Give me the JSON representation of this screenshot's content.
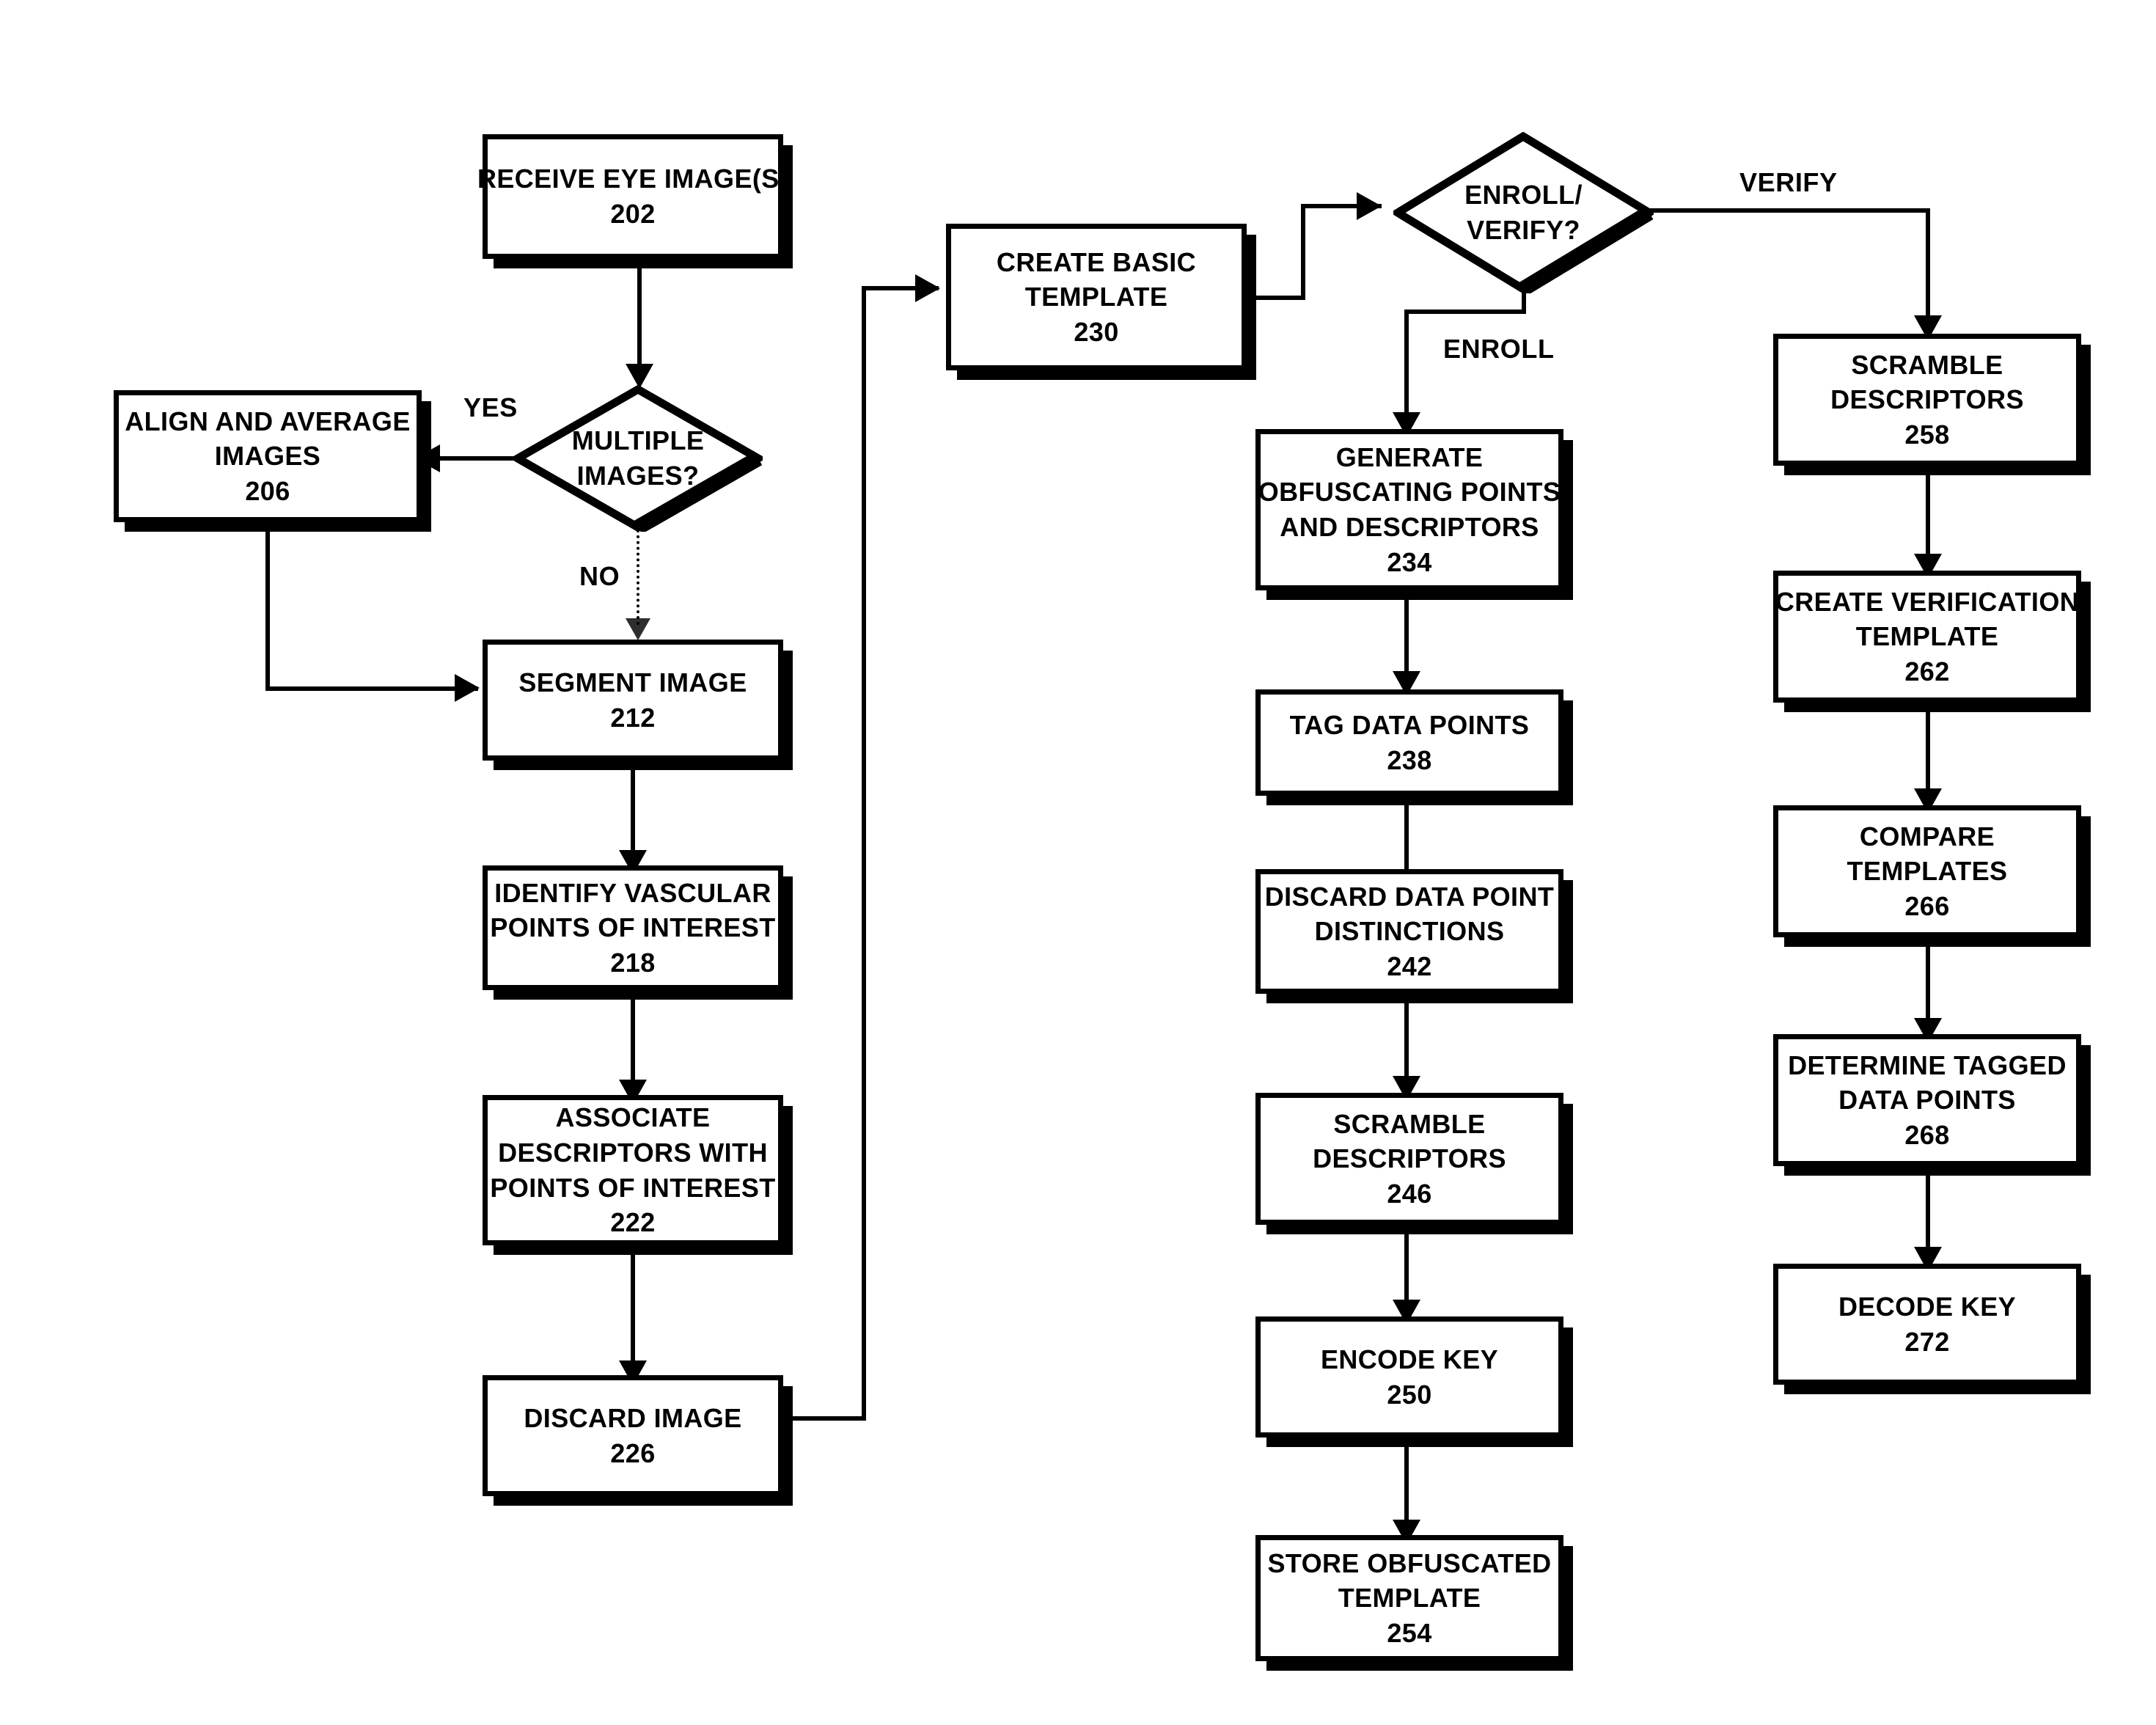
{
  "diagram": {
    "type": "flowchart",
    "title": "",
    "nodes": [
      {
        "id": "202",
        "shape": "process",
        "lines": [
          "RECEIVE EYE IMAGE(S)"
        ],
        "number": "202"
      },
      {
        "id": "204",
        "shape": "decision",
        "lines": [
          "MULTIPLE",
          "IMAGES?"
        ],
        "number": ""
      },
      {
        "id": "206",
        "shape": "process",
        "lines": [
          "ALIGN AND AVERAGE",
          "IMAGES"
        ],
        "number": "206"
      },
      {
        "id": "212",
        "shape": "process",
        "lines": [
          "SEGMENT IMAGE"
        ],
        "number": "212"
      },
      {
        "id": "218",
        "shape": "process",
        "lines": [
          "IDENTIFY VASCULAR",
          "POINTS OF INTEREST"
        ],
        "number": "218"
      },
      {
        "id": "222",
        "shape": "process",
        "lines": [
          "ASSOCIATE",
          "DESCRIPTORS WITH",
          "POINTS OF INTEREST"
        ],
        "number": "222"
      },
      {
        "id": "226",
        "shape": "process",
        "lines": [
          "DISCARD IMAGE"
        ],
        "number": "226"
      },
      {
        "id": "230",
        "shape": "process",
        "lines": [
          "CREATE BASIC",
          "TEMPLATE"
        ],
        "number": "230"
      },
      {
        "id": "232",
        "shape": "decision",
        "lines": [
          "ENROLL/",
          "VERIFY?"
        ],
        "number": ""
      },
      {
        "id": "234",
        "shape": "process",
        "lines": [
          "GENERATE",
          "OBFUSCATING POINTS",
          "AND DESCRIPTORS"
        ],
        "number": "234"
      },
      {
        "id": "238",
        "shape": "process",
        "lines": [
          "TAG DATA POINTS"
        ],
        "number": "238"
      },
      {
        "id": "242",
        "shape": "process",
        "lines": [
          "DISCARD DATA POINT",
          "DISTINCTIONS"
        ],
        "number": "242"
      },
      {
        "id": "246",
        "shape": "process",
        "lines": [
          "SCRAMBLE",
          "DESCRIPTORS"
        ],
        "number": "246"
      },
      {
        "id": "250",
        "shape": "process",
        "lines": [
          "ENCODE KEY"
        ],
        "number": "250"
      },
      {
        "id": "254",
        "shape": "process",
        "lines": [
          "STORE OBFUSCATED",
          "TEMPLATE"
        ],
        "number": "254"
      },
      {
        "id": "258",
        "shape": "process",
        "lines": [
          "SCRAMBLE",
          "DESCRIPTORS"
        ],
        "number": "258"
      },
      {
        "id": "262",
        "shape": "process",
        "lines": [
          "CREATE VERIFICATION",
          "TEMPLATE"
        ],
        "number": "262"
      },
      {
        "id": "266",
        "shape": "process",
        "lines": [
          "COMPARE",
          "TEMPLATES"
        ],
        "number": "266"
      },
      {
        "id": "268",
        "shape": "process",
        "lines": [
          "DETERMINE TAGGED",
          "DATA POINTS"
        ],
        "number": "268"
      },
      {
        "id": "272",
        "shape": "process",
        "lines": [
          "DECODE KEY"
        ],
        "number": "272"
      }
    ],
    "edge_labels": {
      "yes": "YES",
      "no": "NO",
      "enroll": "ENROLL",
      "verify": "VERIFY"
    },
    "colors": {
      "stroke": "#000000",
      "fill": "#ffffff",
      "text": "#000000"
    }
  },
  "n202": {
    "l0": "RECEIVE EYE IMAGE(S)",
    "num": "202"
  },
  "n204": {
    "l0": "MULTIPLE",
    "l1": "IMAGES?"
  },
  "n206": {
    "l0": "ALIGN AND AVERAGE",
    "l1": "IMAGES",
    "num": "206"
  },
  "n212": {
    "l0": "SEGMENT IMAGE",
    "num": "212"
  },
  "n218": {
    "l0": "IDENTIFY VASCULAR",
    "l1": "POINTS OF INTEREST",
    "num": "218"
  },
  "n222": {
    "l0": "ASSOCIATE",
    "l1": "DESCRIPTORS WITH",
    "l2": "POINTS OF INTEREST",
    "num": "222"
  },
  "n226": {
    "l0": "DISCARD IMAGE",
    "num": "226"
  },
  "n230": {
    "l0": "CREATE BASIC",
    "l1": "TEMPLATE",
    "num": "230"
  },
  "n232": {
    "l0": "ENROLL/",
    "l1": "VERIFY?"
  },
  "n234": {
    "l0": "GENERATE",
    "l1": "OBFUSCATING POINTS",
    "l2": "AND DESCRIPTORS",
    "num": "234"
  },
  "n238": {
    "l0": "TAG DATA POINTS",
    "num": "238"
  },
  "n242": {
    "l0": "DISCARD DATA POINT",
    "l1": "DISTINCTIONS",
    "num": "242"
  },
  "n246": {
    "l0": "SCRAMBLE",
    "l1": "DESCRIPTORS",
    "num": "246"
  },
  "n250": {
    "l0": "ENCODE KEY",
    "num": "250"
  },
  "n254": {
    "l0": "STORE OBFUSCATED",
    "l1": "TEMPLATE",
    "num": "254"
  },
  "n258": {
    "l0": "SCRAMBLE",
    "l1": "DESCRIPTORS",
    "num": "258"
  },
  "n262": {
    "l0": "CREATE VERIFICATION",
    "l1": "TEMPLATE",
    "num": "262"
  },
  "n266": {
    "l0": "COMPARE",
    "l1": "TEMPLATES",
    "num": "266"
  },
  "n268": {
    "l0": "DETERMINE TAGGED",
    "l1": "DATA POINTS",
    "num": "268"
  },
  "n272": {
    "l0": "DECODE KEY",
    "num": "272"
  },
  "labels": {
    "yes": "YES",
    "no": "NO",
    "enroll": "ENROLL",
    "verify": "VERIFY"
  }
}
